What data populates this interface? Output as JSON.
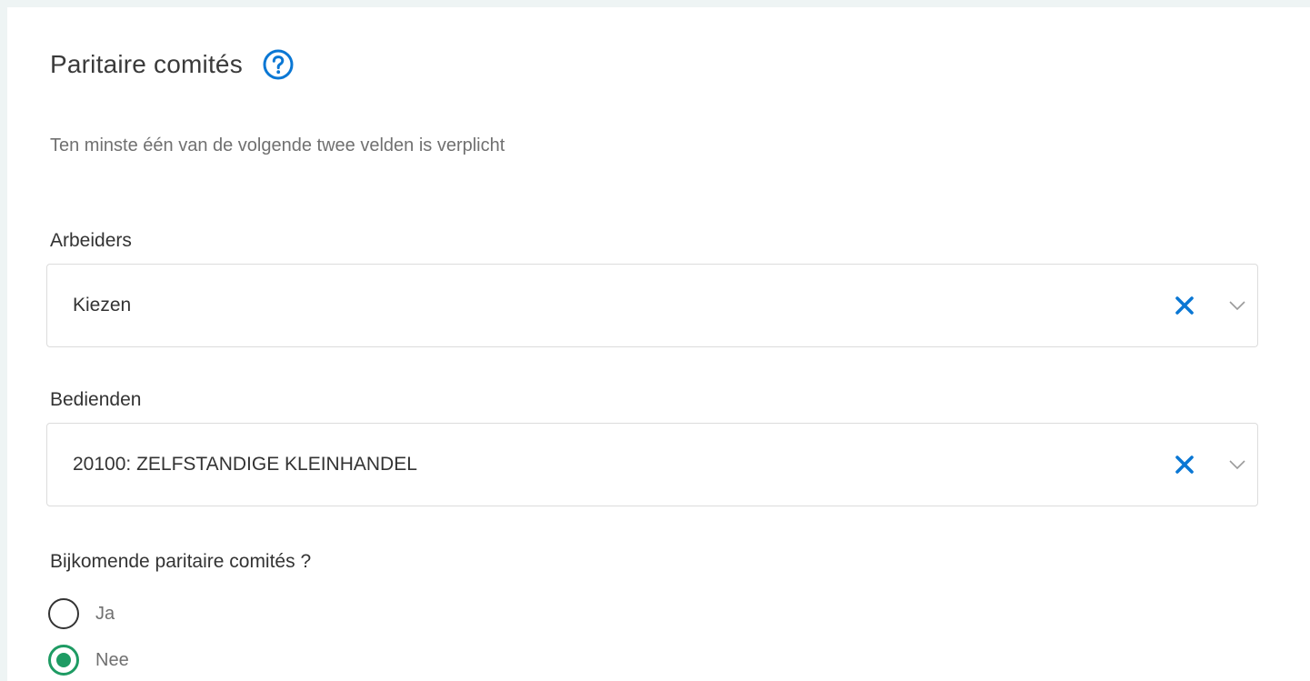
{
  "section": {
    "title": "Paritaire comités",
    "help_icon": "question-circle-icon",
    "subtitle": "Ten minste één van de volgende twee velden is verplicht"
  },
  "fields": {
    "arbeiders": {
      "label": "Arbeiders",
      "value": "Kiezen"
    },
    "bedienden": {
      "label": "Bedienden",
      "value": "20100: ZELFSTANDIGE KLEINHANDEL"
    }
  },
  "additional": {
    "question": "Bijkomende paritaire comités ?",
    "options": [
      {
        "label": "Ja",
        "checked": false
      },
      {
        "label": "Nee",
        "checked": true
      }
    ]
  },
  "colors": {
    "accent_blue": "#0a77d4",
    "radio_green": "#1e9b63"
  }
}
